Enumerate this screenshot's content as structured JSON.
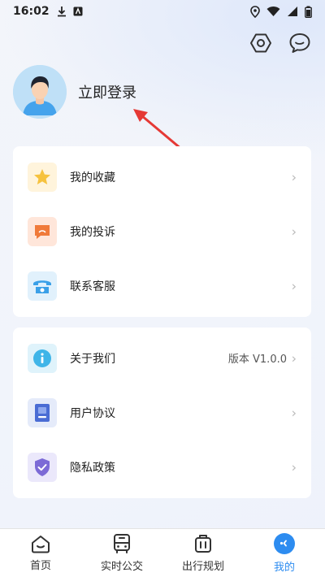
{
  "status_bar": {
    "time": "16:02"
  },
  "profile": {
    "login_label": "立即登录"
  },
  "menu_group_1": [
    {
      "label": "我的收藏",
      "icon": "star-icon",
      "color": "#f6c23e",
      "bg": "#fff6e0"
    },
    {
      "label": "我的投诉",
      "icon": "complaint-icon",
      "color": "#f07a3a",
      "bg": "#ffe9df"
    },
    {
      "label": "联系客服",
      "icon": "phone-icon",
      "color": "#3aa0e8",
      "bg": "#e3f2fd"
    }
  ],
  "menu_group_2": [
    {
      "label": "关于我们",
      "value": "版本 V1.0.0",
      "icon": "info-icon",
      "color": "#3fb5e8",
      "bg": "#e1f5fc"
    },
    {
      "label": "用户协议",
      "icon": "document-icon",
      "color": "#4a6cd4",
      "bg": "#e6ecfa"
    },
    {
      "label": "隐私政策",
      "icon": "shield-icon",
      "color": "#7c6ad6",
      "bg": "#ece9fb"
    }
  ],
  "tabbar": {
    "tabs": [
      {
        "label": "首页",
        "icon": "home-icon"
      },
      {
        "label": "实时公交",
        "icon": "bus-icon"
      },
      {
        "label": "出行规划",
        "icon": "luggage-icon"
      },
      {
        "label": "我的",
        "icon": "profile-icon",
        "active": true
      }
    ],
    "active_color": "#2d8cf0"
  }
}
